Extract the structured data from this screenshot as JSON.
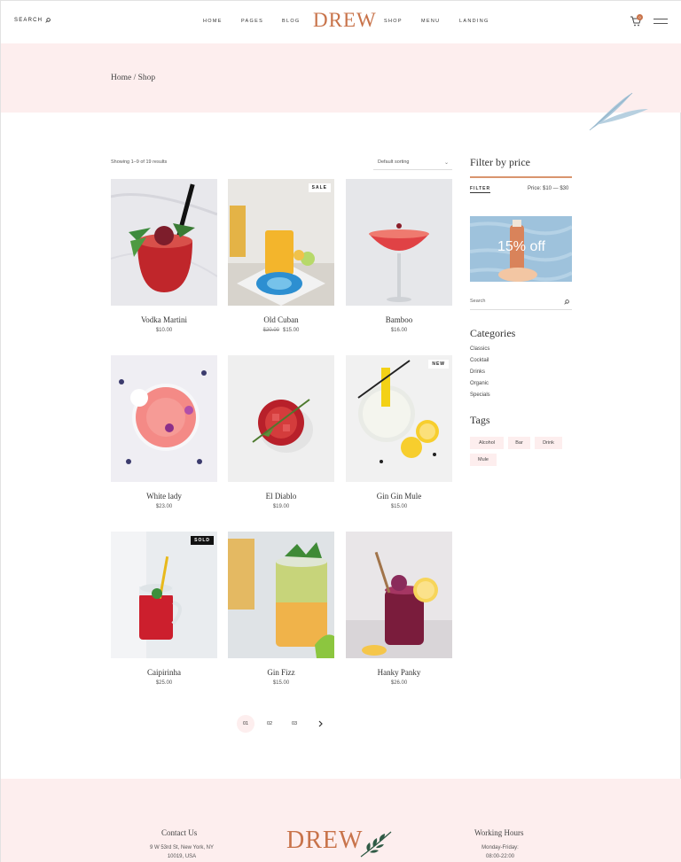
{
  "header": {
    "search_label": "SEARCH",
    "nav_left": [
      "HOME",
      "PAGES",
      "BLOG"
    ],
    "logo": "DREW",
    "nav_right": [
      "SHOP",
      "MENU",
      "LANDING"
    ],
    "cart_count": "0",
    "accent_color": "#c8734a"
  },
  "breadcrumb": "Home / Shop",
  "shop": {
    "results_text": "Showing 1–9 of 19 results",
    "sorting": "Default sorting",
    "products": [
      {
        "name": "Vodka Martini",
        "price": "$10.00",
        "old_price": "",
        "tag": ""
      },
      {
        "name": "Old Cuban",
        "price": "$15.00",
        "old_price": "$20.00",
        "tag": "SALE"
      },
      {
        "name": "Bamboo",
        "price": "$16.00",
        "old_price": "",
        "tag": ""
      },
      {
        "name": "White lady",
        "price": "$23.00",
        "old_price": "",
        "tag": ""
      },
      {
        "name": "El Diablo",
        "price": "$19.00",
        "old_price": "",
        "tag": ""
      },
      {
        "name": "Gin Gin Mule",
        "price": "$15.00",
        "old_price": "",
        "tag": "NEW"
      },
      {
        "name": "Caipirinha",
        "price": "$25.00",
        "old_price": "",
        "tag": "SOLD"
      },
      {
        "name": "Gin Fizz",
        "price": "$15.00",
        "old_price": "",
        "tag": ""
      },
      {
        "name": "Hanky Panky",
        "price": "$26.00",
        "old_price": "",
        "tag": ""
      }
    ],
    "pagination": [
      "01",
      "02",
      "03"
    ],
    "next_icon": "chevron-right-icon"
  },
  "sidebar": {
    "filter_title": "Filter by price",
    "filter_button": "FILTER",
    "price_range": "Price: $10 — $30",
    "promo_text": "15% off",
    "search_placeholder": "Search",
    "categories_title": "Categories",
    "categories": [
      "Classics",
      "Cocktail",
      "Drinks",
      "Organic",
      "Specials"
    ],
    "tags_title": "Tags",
    "tags": [
      "Alcohol",
      "Bar",
      "Drink",
      "Mule"
    ]
  },
  "footer": {
    "contact_title": "Contact Us",
    "contact_address_1": "9 W 53rd St, New York, NY",
    "contact_address_2": "10019, USA",
    "logo": "DREW",
    "hours_title": "Working Hours",
    "hours_days": "Monday-Friday:",
    "hours_time": "08:00-22:00"
  }
}
